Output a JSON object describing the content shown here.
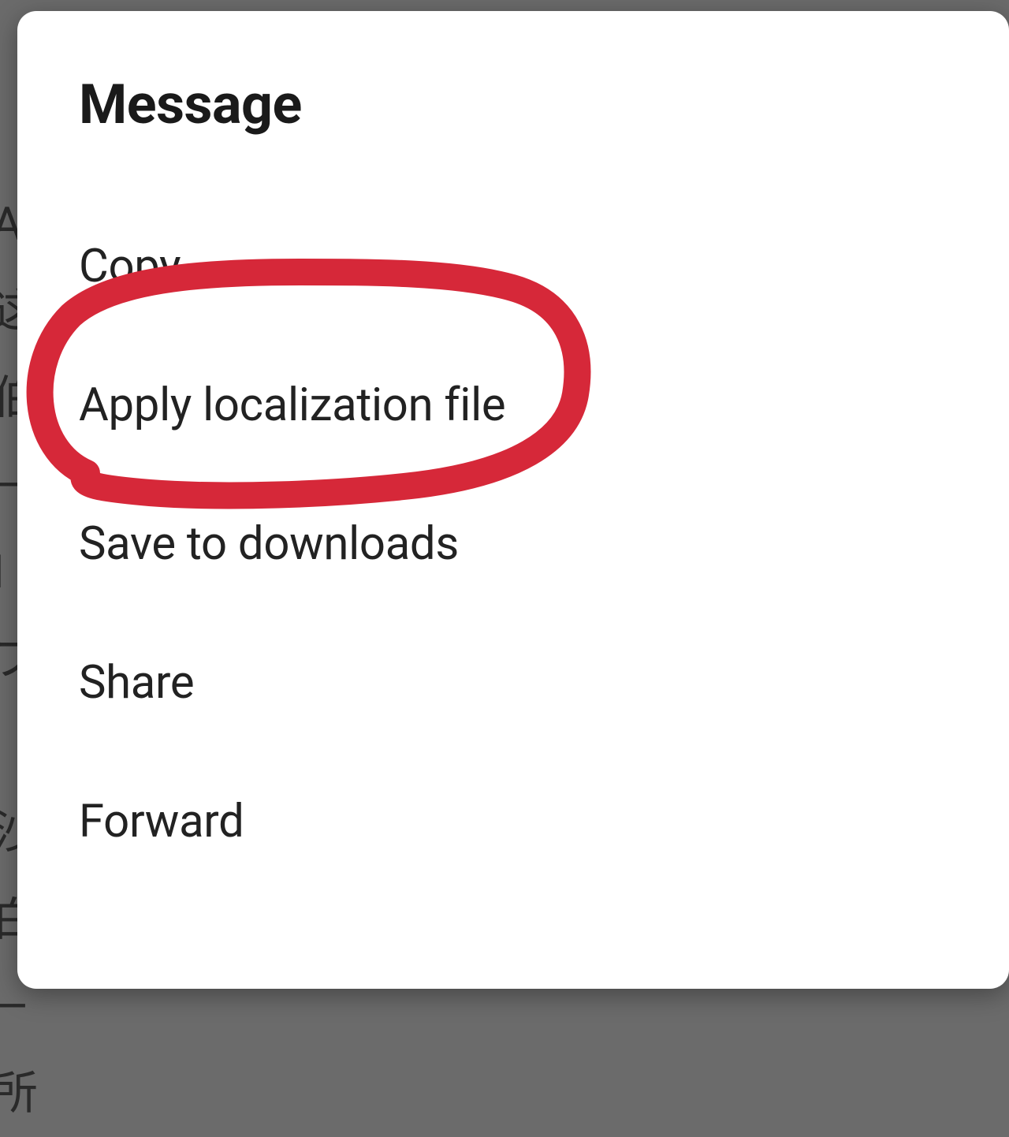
{
  "dialog": {
    "title": "Message",
    "items": [
      "Copy",
      "Apply localization file",
      "Save to downloads",
      "Share",
      "Forward"
    ]
  },
  "backdrop": {
    "lines": "A\n这\n伯\n—\nI\nプ\n\n沙\n白\n—\n所"
  },
  "annotation": {
    "color": "#d62839",
    "highlighted_index": 1
  }
}
